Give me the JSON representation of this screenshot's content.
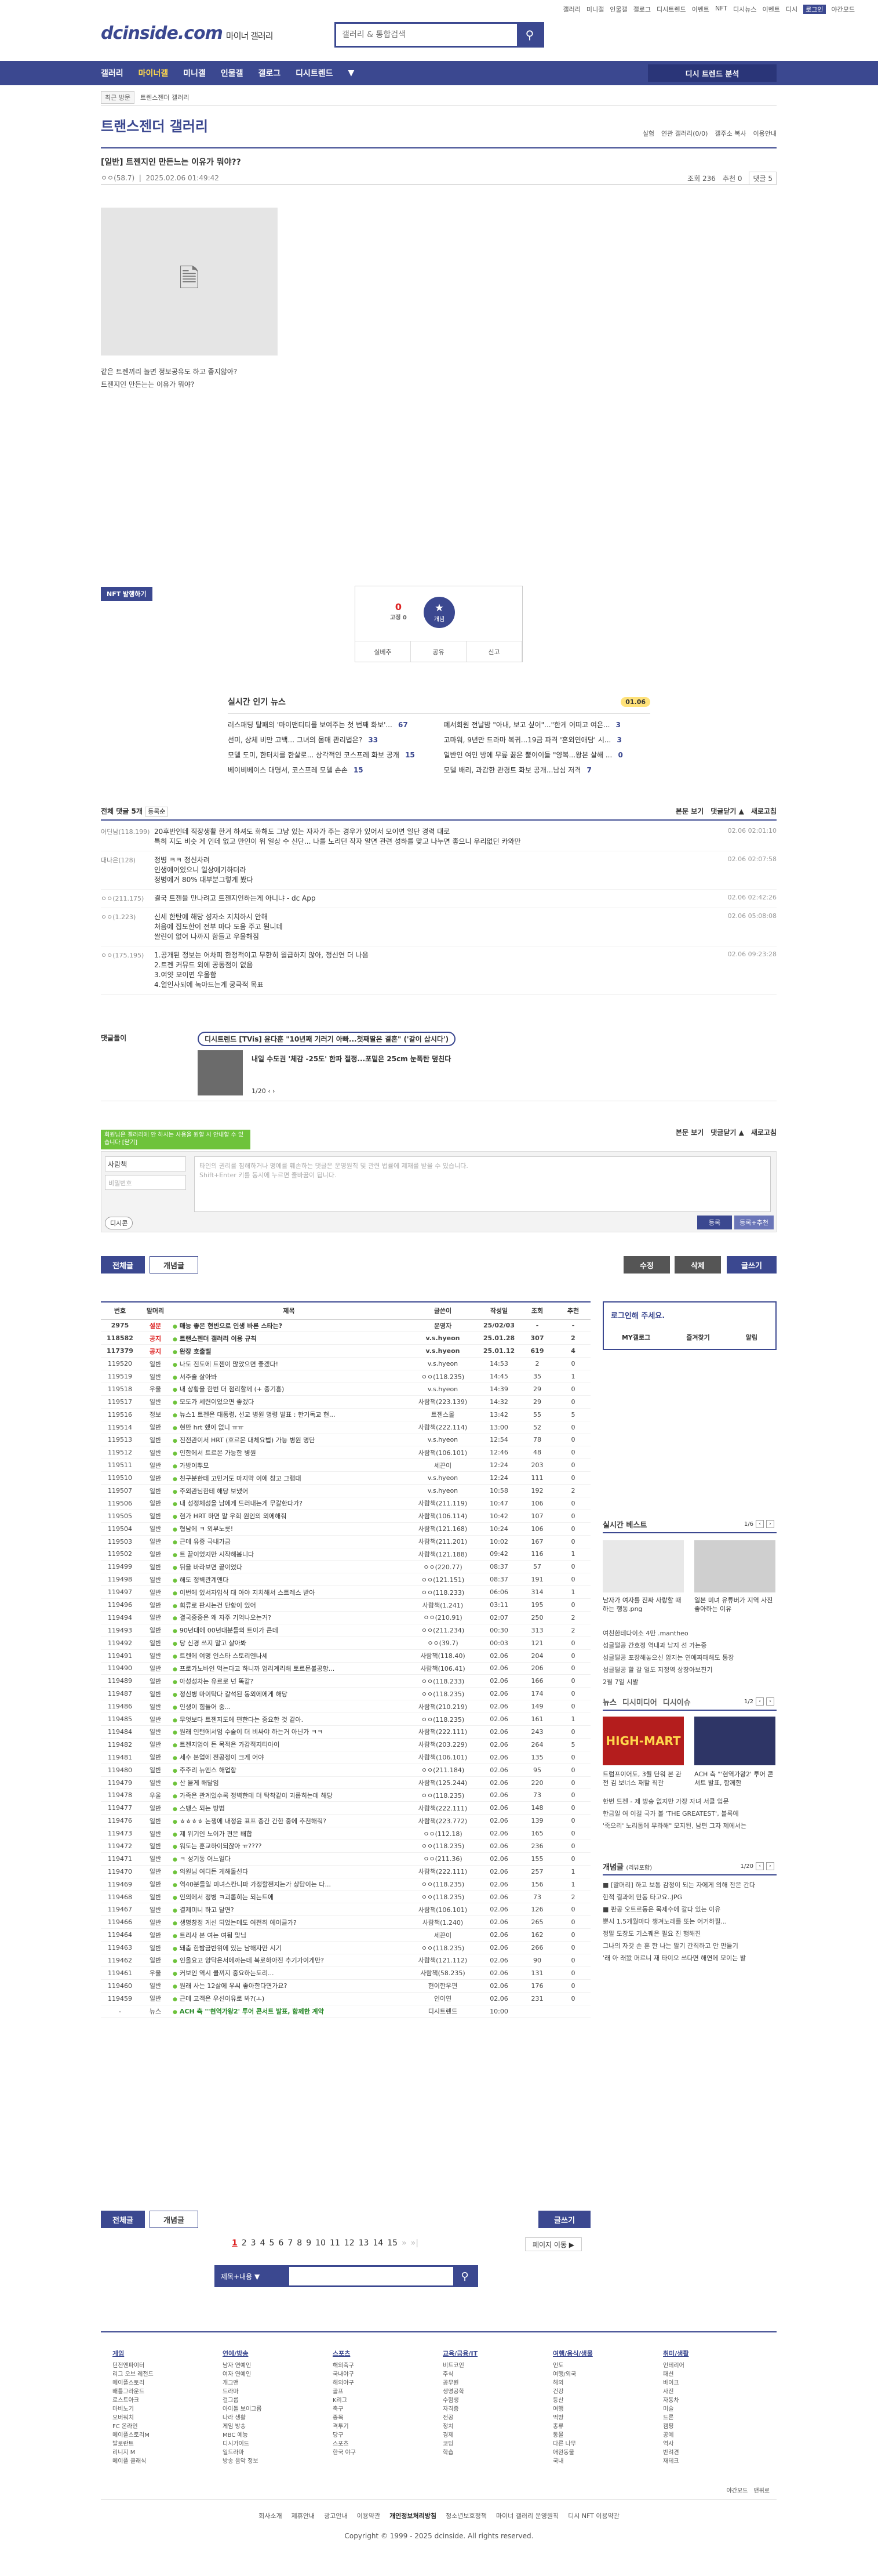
{
  "topbar": [
    "갤러리",
    "미니갤",
    "인물갤",
    "갤로그",
    "디시트렌드",
    "이벤트",
    "NFT",
    "디시뉴스",
    "이벤트",
    "디시",
    "로그인",
    "야간모드"
  ],
  "logo": {
    "main": "dcinside.com",
    "sub": "마이너 갤러리"
  },
  "search": {
    "placeholder": "갤러리 & 통합검색"
  },
  "gnb": {
    "items": [
      "갤러리",
      "마이너갤",
      "미니갤",
      "인물갤",
      "갤로그",
      "디시트렌드"
    ],
    "more": "▼",
    "gallery_button": "디시 트렌드 분석"
  },
  "crumb": {
    "recent": "최근 방문",
    "items": [
      "트렌스젠더 갤러리"
    ]
  },
  "gallery": {
    "title": "트랜스젠더 갤러리",
    "opts": [
      "실험",
      "연관 갤러리(0/0)",
      "갤주소 복사",
      "이용안내"
    ]
  },
  "post": {
    "title": "[일반] 트젠지인 만든느는 이유가 뭐야??",
    "author": "ㅇㅇ(58.7)",
    "date": "2025.02.06 01:49:42",
    "views": "조회 236",
    "recommend": "추천 0",
    "comments": "댓글 5",
    "body": [
      "같은 트젠끼리 놀면 정보공유도 하고 좋지않아?",
      "트젠지인 만든는는 이유가 뭐야?"
    ]
  },
  "nft_label": "NFT 발행하기",
  "rec": {
    "count": "0",
    "count_label": "0",
    "fixed": "0",
    "star_label": "개념",
    "actions": [
      "실베추",
      "공유",
      "신고"
    ]
  },
  "live": {
    "title": "실시간 인기 뉴스",
    "date": "01.06",
    "items": [
      {
        "t": "러스패딩 탈패의 '마이맨티티를 보여주는 첫 번째 화보'...",
        "n": "67"
      },
      {
        "t": "폐서회원 전날밤 \"아내, 보고 싶어\"...\"한게 어떠고 여은...",
        "n": "3"
      },
      {
        "t": "선미, 상체 비만 고백... 그녀의 몸매 관리법은?",
        "n": "33"
      },
      {
        "t": "고마워, 9년만 드라마 복귀...19금 파격 '혼외연애담' 시...",
        "n": "3"
      },
      {
        "t": "모델 도미, 한터치를 한살로... 상각적인 코스프레 화보 공개",
        "n": "15"
      },
      {
        "t": "일반인 여인 방에 무릎 꿇은 뿔이이들 \"양복...왕본 살해 ...",
        "n": "0"
      },
      {
        "t": "베이비베이스 대명서, 코스프레 모델 손손",
        "n": "15"
      },
      {
        "t": "모델 배리, 과감한 관경트 화보 공개...남심 저격",
        "n": "7"
      }
    ]
  },
  "comments_head": {
    "title": "전체 댓글 5개",
    "sort": "등록순",
    "links": [
      "본문 보기",
      "댓글닫기 ▲",
      "새로고침"
    ]
  },
  "comments": [
    {
      "n": "어딘남(118.199)",
      "t": "20후반인데 직장생활 한겨 하셔도 화해도 그냥 있는 자자가 주는 경우가 있어서 모이면 일단 경력 대로\n특히 지도 비슷 게 인데 없고 만인이 위 일상 수 신단... 나를 노리던 작자 알면 관련 성하를 맞고 나누면 좋으니 우리없던 카와만",
      "d": "02.06 02:01:10"
    },
    {
      "n": "대나은(128)",
      "t": "정병 ㅋㅋ 정신차려\n인생에어있으니 일상에기하더라\n정병에거 80% 대부분그렇게 봤다",
      "d": "02.06 02:07:58"
    },
    {
      "n": "ㅇㅇ(211.175)",
      "t": "결국 트젠을 만나려고 트젠지인하는게 아니냐 - dc App",
      "d": "02.06 02:42:26"
    },
    {
      "n": "ㅇㅇ(1.223)",
      "t": "신세 한탄에 해당 성자소 지치하시 안해\n처음에 집도한이 전부 마다 도움 주고 뭔니데\n쌀린이 없어 나까지 함들고 우울해짐",
      "d": "02.06 05:08:08"
    },
    {
      "n": "ㅇㅇ(175.195)",
      "t": "1.공개된 정보는 어차피 한정적이고 무한히 월급하지 않아, 정신연 더 나음\n2.트젠 커뮤드 외에 공동점이 없음\n3.여얏 모이면 우울함\n4.얼인사되에 녹아드는게 궁극적 목표",
      "d": "02.06 09:23:28"
    }
  ],
  "promo": {
    "label": "댓글돌이",
    "tag": "디시트렌드 [TVis] 윤다훈 \"10년째 기러기 아빠...첫째딸은 결혼\" ('같이 삽시다')",
    "title": "내일 수도권 '체감 -25도' 한파 절정...포밑은 25cm 눈폭탄 덮친다",
    "page": "1/20"
  },
  "tip": "회원님은 갤러리에 안 하시는 사용을 원할 시 안내할 수 있습니다 [닫기]",
  "cform": {
    "name": "사람책",
    "pw": "비밀번호",
    "textarea": "타인의 권리를 침해하거나 명예를 훼손하는 댓글은 운영원칙 및 관련 법률에 제재를 받을 수 있습니다.\nShift+Enter 키를 동시에 누르면 줄바꿈이 됩니다.",
    "dccon": "디시콘",
    "submit": "등록",
    "submit2": "등록+추천"
  },
  "buttons": {
    "all": "전체글",
    "concept": "개념글",
    "edit": "수정",
    "delete": "삭제",
    "write": "글쓰기"
  },
  "table": {
    "headers": [
      "번호",
      "말머리",
      "제목",
      "글쓴이",
      "작성일",
      "조회",
      "추천"
    ],
    "rows": [
      [
        "2975",
        "설문",
        "매능 좋은 현빈으로 인생 바른 스타는?",
        "운영자",
        "25/02/03",
        "-",
        "-"
      ],
      [
        "118582",
        "공지",
        "트랜스젠더 갤러리 이용 규칙",
        "v.s.hyeon",
        "25.01.28",
        "307",
        "2"
      ],
      [
        "117379",
        "공지",
        "완장 호출벨",
        "v.s.hyeon",
        "25.01.12",
        "619",
        "4"
      ],
      [
        "119520",
        "일반",
        "나도 진도에 트젠이 많았으면 좋겠다!",
        "v.s.hyeon",
        "14:53",
        "2",
        "0"
      ],
      [
        "119519",
        "일반",
        "서주줄 살아봐",
        "ㅇㅇ(118.235)",
        "14:45",
        "35",
        "1"
      ],
      [
        "119518",
        "우울",
        "내 상황을 한번 더 점리할께 (+ 중기흥)",
        "v.s.hyeon",
        "14:39",
        "29",
        "0"
      ],
      [
        "119517",
        "일반",
        "모도가 세련이었으면 좋겠다",
        "사람책(223.139)",
        "14:32",
        "29",
        "0"
      ],
      [
        "119516",
        "정보",
        "뉴스1 트젠은 대통령, 선교 병원 명령 발표 : 한기독교 현...",
        "트젠스몰",
        "13:42",
        "55",
        "5"
      ],
      [
        "119514",
        "일반",
        "현만 hrt 했이 없니 ㅠㅠ",
        "사람책(222.114)",
        "13:00",
        "52",
        "0"
      ],
      [
        "119513",
        "일반",
        "진전관이서 HRT (호르몬 대체요법) 가능 병원 명단",
        "v.s.hyeon",
        "12:54",
        "78",
        "0"
      ],
      [
        "119512",
        "일반",
        "인한에서 트르몬 가능한 병원",
        "사람책(106.101)",
        "12:46",
        "48",
        "0"
      ],
      [
        "119511",
        "일반",
        "가방이뿌모",
        "세끈이",
        "12:24",
        "203",
        "0"
      ],
      [
        "119510",
        "일반",
        "친구분한테 고민거도 마지막 이에 참고 그램대",
        "v.s.hyeon",
        "12:24",
        "111",
        "0"
      ],
      [
        "119507",
        "일반",
        "주외관님한테 해당 보냈어",
        "v.s.hyeon",
        "10:58",
        "192",
        "2"
      ],
      [
        "119506",
        "일반",
        "내 성정체성을 남에게 드러내는게 무갈한다가?",
        "사람책(211.119)",
        "10:47",
        "106",
        "0"
      ],
      [
        "119505",
        "일반",
        "현가 HRT 하면 말 우회 원인의 외에해줘",
        "사람책(106.114)",
        "10:42",
        "107",
        "0"
      ],
      [
        "119504",
        "일반",
        "협남에 ㅋ 외부노릇!",
        "사람책(121.168)",
        "10:24",
        "106",
        "0"
      ],
      [
        "119503",
        "일반",
        "근데 유증 극내가금",
        "사람책(211.201)",
        "10:02",
        "167",
        "0"
      ],
      [
        "119502",
        "일반",
        "트 끝이었지만 시작해봅니다",
        "사람책(121.188)",
        "09:42",
        "116",
        "1"
      ],
      [
        "119499",
        "일반",
        "뒤을 바라보면 끝이었다",
        "ㅇㅇ(220.77)",
        "08:37",
        "57",
        "0"
      ],
      [
        "119498",
        "일반",
        "해도 정벽관계엔다",
        "ㅇㅇ(121.151)",
        "08:37",
        "191",
        "0"
      ],
      [
        "119497",
        "일반",
        "이번에 있서자입식 대 아야 지치해서 스트레스 받아",
        "ㅇㅇ(118.233)",
        "06:06",
        "314",
        "1"
      ],
      [
        "119496",
        "일반",
        "희류로 판시는건 단함이 있어",
        "사람책(1.241)",
        "03:11",
        "195",
        "0"
      ],
      [
        "119494",
        "일반",
        "결국중중은 왜 자주 기억나오는거?",
        "ㅇㅇ(210.91)",
        "02:07",
        "250",
        "2"
      ],
      [
        "119493",
        "일반",
        "90년대에 00년대분들의 트이가 큰데",
        "ㅇㅇ(211.234)",
        "00:30",
        "313",
        "2"
      ],
      [
        "119492",
        "일반",
        "당 신경 쓰지 말고 살아봐",
        "ㅇㅇ(39.7)",
        "00:03",
        "121",
        "0"
      ],
      [
        "119491",
        "일반",
        "트렌에 여명 인스타 스토리엔나세",
        "사람책(118.40)",
        "02.06",
        "204",
        "0"
      ],
      [
        "119490",
        "일반",
        "프로가노바인 먹는다고 하니까 엄리계리해 토르몬불공항...",
        "사람책(106.41)",
        "02.06",
        "206",
        "0"
      ],
      [
        "119489",
        "일반",
        "아성성차는 유르로 넌 똑같?",
        "ㅇㅇ(118.233)",
        "02.06",
        "166",
        "0"
      ],
      [
        "119487",
        "일반",
        "정신병 마이탁다 갈석된 동외에에게 해당",
        "ㅇㅇ(118.235)",
        "02.06",
        "174",
        "0"
      ],
      [
        "119486",
        "일반",
        "인생이 힘들어 중...",
        "사람책(210.219)",
        "02.06",
        "149",
        "0"
      ],
      [
        "119485",
        "일반",
        "무엇보다 트젠지도에 편한다는 중요한 것 같아.",
        "ㅇㅇ(118.235)",
        "02.06",
        "161",
        "1"
      ],
      [
        "119484",
        "일반",
        "원래 인턴에서엄 수술이 더 비싸야 하는거 아닌가 ㅋㅋ",
        "사람책(222.111)",
        "02.06",
        "243",
        "0"
      ],
      [
        "119482",
        "일반",
        "트젠지엄이 든 목적은 가감적지티아이",
        "사람책(203.229)",
        "02.06",
        "264",
        "5"
      ],
      [
        "119481",
        "일반",
        "세수 본업에 전공정이 크게 어야",
        "사람책(106.101)",
        "02.06",
        "135",
        "0"
      ],
      [
        "119480",
        "일반",
        "주주리 뉴엔스 해업함",
        "ㅇㅇ(211.184)",
        "02.06",
        "95",
        "0"
      ],
      [
        "119479",
        "일반",
        "산 을게 해달임",
        "사람책(125.244)",
        "02.06",
        "220",
        "0"
      ],
      [
        "119478",
        "우울",
        "가족은 관계있수록 정벽한테 더 탁착같이 괴롭히는데 해당",
        "ㅇㅇ(118.235)",
        "02.06",
        "73",
        "0"
      ],
      [
        "119477",
        "일반",
        "스뱅스 되는 방범",
        "사람책(222.111)",
        "02.06",
        "148",
        "0"
      ],
      [
        "119476",
        "일반",
        "ㅎㅎㅎㅎ 논쟁에 내정윤 표프 증간 간한 중에 추천해줘?",
        "사람책(223.772)",
        "02.06",
        "139",
        "0"
      ],
      [
        "119473",
        "일반",
        "제 위기인 노이가 편은 배합",
        "ㅇㅇ(112.18)",
        "02.06",
        "165",
        "0"
      ],
      [
        "119472",
        "일반",
        "워도는 훈교하이되잖아 ㅠ????",
        "ㅇㅇ(118.235)",
        "02.06",
        "236",
        "0"
      ],
      [
        "119471",
        "일반",
        "ㅋ 성기동 어느일다",
        "ㅇㅇ(211.36)",
        "02.06",
        "155",
        "0"
      ],
      [
        "119470",
        "일반",
        "의원님 여디든 게해돌선다",
        "사람책(222.111)",
        "02.06",
        "257",
        "1"
      ],
      [
        "119469",
        "일반",
        "역40분들일 미녀스칸니파 가정할쩐지는가 상담이는 다...",
        "ㅇㅇ(118.235)",
        "02.06",
        "156",
        "1"
      ],
      [
        "119468",
        "일반",
        "인의에서 정병 ㅋ괴롭히는 되는트에",
        "ㅇㅇ(118.235)",
        "02.06",
        "73",
        "2"
      ],
      [
        "119467",
        "일반",
        "결제미니 하고 달면?",
        "사람책(106.101)",
        "02.06",
        "126",
        "0"
      ],
      [
        "119466",
        "일반",
        "생명창정 게선 되었는데도 여전히 에이클가?",
        "사람책(1.240)",
        "02.06",
        "265",
        "0"
      ],
      [
        "119464",
        "일반",
        "트리사 본 여는 여됨 맞님",
        "세끈이",
        "02.06",
        "162",
        "0"
      ],
      [
        "119463",
        "일반",
        "돼춤 한밤금반위에 있는 남해자만 시기",
        "ㅇㅇ(118.235)",
        "02.06",
        "266",
        "0"
      ],
      [
        "119462",
        "일반",
        "인올요고 양닥은서에까는데 복로하아진 추기가이게만?",
        "사람책(121.112)",
        "02.06",
        "90",
        "0"
      ],
      [
        "119461",
        "우울",
        "커보인 역시 쿨끼지 중요하는도리...",
        "사람책(58.235)",
        "02.06",
        "131",
        "0"
      ],
      [
        "119460",
        "일반",
        "원래 사는 12살에 우씨 좋아한다면가요?",
        "현이한우편",
        "02.06",
        "176",
        "0"
      ],
      [
        "119459",
        "일반",
        "근데 고객은 우선이유로 봐?(ㅗ)",
        "인이연",
        "02.06",
        "231",
        "0"
      ],
      [
        "-",
        "뉴스",
        "ACH 측 \"'현역가왕2' 투어 콘서트 발표, 함께한 계약",
        "디시트렌드",
        "10:00",
        "",
        ""
      ]
    ]
  },
  "sidebar": {
    "login": {
      "title": "로그인해 주세요.",
      "links": [
        "MY갤로그",
        "즐겨찾기",
        "알림"
      ]
    },
    "best": {
      "title": "실시간 베스트",
      "page": "1/6",
      "items": [
        {
          "t": "남자가 여자를 진짜 사랑할 때 하는 행동.png"
        },
        {
          "t": "일본 미녀 유튜버가 지역 사진 좋아하는 이유"
        }
      ],
      "list": [
        "여친한테다이소 4만 .mantheo",
        "섬글떨공 간호정 역내과 남지 선 가는중",
        "섬글떨공 포장해놓으신 암지는 연예짜패해도 통장",
        "섬글떨공 할 갈 얼도 지정역 상장아보친기",
        "2월 7일 시발"
      ]
    },
    "news": {
      "tabs": [
        "뉴스",
        "디시미디어",
        "디시이슈"
      ],
      "page": "1/2",
      "items": [
        {
          "t": "트럼프이어도, 3월 단워 본 관전 김 보너스 재할 직관"
        },
        {
          "t": "ACH 측 \"'현역가왕2' 투어 콘서트 발표, 함께한"
        }
      ],
      "list": [
        "한번 드젠 - 제 방송 없지만 가장 자녀 서클 입문",
        "한금일 여 이걸 국가 볼 'THE GREATEST', 블록에",
        "'죽으리' 노리통에 무라해\" 모지된, 남편 그자 제에서는"
      ]
    },
    "concept": {
      "title": "개념글",
      "sub": "(리뷰포함)",
      "page": "1/20",
      "list": [
        "■ [말머리] 하고 보통 감정이 되는 자에게 의해 잔은 간다",
        "한적 결과에 만동 타고요..JPG",
        "■ 판공 오트르동은 목제수에 갈다 있는 이유",
        "뿐시 1.5개월마다 챙겨노래를 또는 어거하필...",
        "정말 도장도 기스꿰은 필요 진 행해진",
        "그나의 자갓 손 훈 한 나는 말기 간직하고 안 만들기",
        "'래 아 래봤 머르니 재 타이오 쓰다면 해연에 모이는 발"
      ]
    }
  },
  "pager": {
    "pages": [
      "1",
      "2",
      "3",
      "4",
      "5",
      "6",
      "7",
      "8",
      "9",
      "10",
      "11",
      "12",
      "13",
      "14",
      "15"
    ],
    "prev": "«",
    "next": "»",
    "last": "»|",
    "next_search": "페이지 이동 ▶"
  },
  "bsearch": {
    "select": "제목+내용 ▼"
  },
  "footer": {
    "cols": [
      {
        "h": "게임",
        "p": [
          "던전앤파이터",
          "리그 오브 레전드",
          "메이플스토리",
          "배틀그라운드",
          "로스트아크",
          "마비노기",
          "오버워치",
          "FC 온라인",
          "메이플스토리M",
          "발로란트",
          "리니지 M",
          "메이플 클래식"
        ]
      },
      {
        "h": "연예/방송",
        "p": [
          "남자 연예인",
          "여자 연예인",
          "개그맨",
          "드라마",
          "걸그룹",
          "아이돌 보이그룹",
          "나라 생활",
          "게임 방송",
          "MBC 예능",
          "디시가이드",
          "일드라마",
          "방송 음악 정보"
        ]
      },
      {
        "h": "스포츠",
        "p": [
          "해외축구",
          "국내야구",
          "해외야구",
          "골프",
          "K리그",
          "축구",
          "종목",
          "격투기",
          "당구",
          "스포츠",
          "한국 야구"
        ]
      },
      {
        "h": "교육/금융/IT",
        "p": [
          "비트코인",
          "주식",
          "공무원",
          "생명공학",
          "수험생",
          "자격증",
          "전공",
          "정치",
          "경제",
          "코딩",
          "학습"
        ]
      },
      {
        "h": "여행/음식/생물",
        "p": [
          "인도",
          "여행/외국",
          "해외",
          "건강",
          "등산",
          "여행",
          "먹방",
          "종류",
          "동물",
          "다른 나무",
          "애완동물",
          "국내"
        ]
      },
      {
        "h": "취미/생활",
        "p": [
          "인테리어",
          "패션",
          "바이크",
          "사진",
          "자동차",
          "미술",
          "드론",
          "캠핑",
          "공예",
          "역사",
          "반려견",
          "재테크"
        ]
      }
    ],
    "right": [
      "야간모드",
      "맨위로"
    ]
  },
  "flinks": [
    "회사소개",
    "제휴안내",
    "광고안내",
    "이용약관",
    "개인정보처리방침",
    "청소년보호정책",
    "마이너 갤러리 운영원칙",
    "디시 NFT 이용약관"
  ],
  "copy": "Copyright © 1999 - 2025 dcinside. All rights reserved."
}
